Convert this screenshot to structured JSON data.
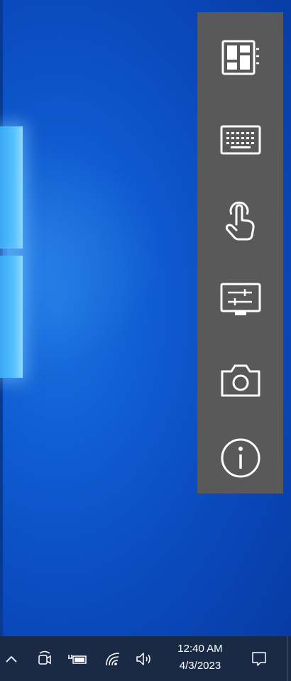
{
  "panel": {
    "buttons": [
      {
        "icon": "layout-panel-icon"
      },
      {
        "icon": "keyboard-icon"
      },
      {
        "icon": "touch-hand-icon"
      },
      {
        "icon": "display-settings-icon"
      },
      {
        "icon": "camera-icon"
      },
      {
        "icon": "info-icon"
      }
    ]
  },
  "taskbar": {
    "icons": [
      "chevron-up-icon",
      "meet-now-icon",
      "battery-charging-icon",
      "wifi-icon",
      "volume-icon",
      "notification-icon"
    ],
    "time": "12:40 AM",
    "date": "4/3/2023"
  },
  "colors": {
    "desktop_blue": "#0a49bd",
    "panel_gray": "#595959",
    "taskbar": "#1a2a45",
    "icon_white": "#ffffff"
  }
}
